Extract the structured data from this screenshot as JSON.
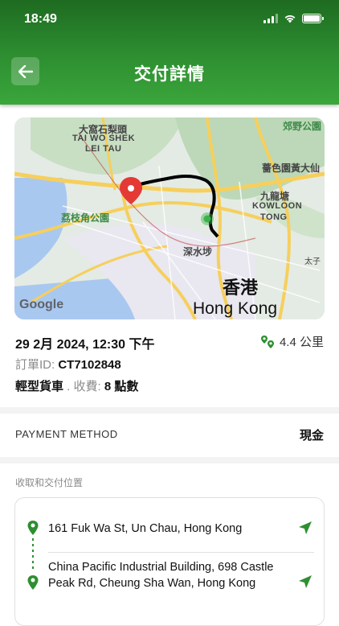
{
  "status_bar": {
    "time": "18:49"
  },
  "header": {
    "title": "交付詳情"
  },
  "map": {
    "labels": [
      "大窩石梨頭",
      "TAI WO SHEK",
      "LEI TAU",
      "郊野公園",
      "薔色園黃大仙",
      "荔枝角公園",
      "九龍塘",
      "KOWLOON",
      "TONG",
      "深水埗",
      "香港",
      "Hong Kong",
      "太子",
      "Google"
    ],
    "route_color": "#000000",
    "pin_color": "#e53935"
  },
  "order": {
    "datetime": "29 2月 2024, 12:30 下午",
    "distance": "4.4 公里",
    "order_id_label": "訂單ID:",
    "order_id": "CT7102848",
    "vehicle": "輕型貨車",
    "fee_sep": " . ",
    "fee_label": "收費:",
    "fee_value": "8 點數"
  },
  "payment": {
    "label": "PAYMENT METHOD",
    "value": "現金"
  },
  "locations": {
    "section_title": "收取和交付位置",
    "pickup": "161 Fuk Wa St, Un Chau, Hong Kong",
    "dropoff": "China Pacific Industrial Building, 698 Castle Peak Rd, Cheung Sha Wan, Hong Kong"
  },
  "colors": {
    "brand": "#2e8f31",
    "pin": "#2e8f31"
  }
}
